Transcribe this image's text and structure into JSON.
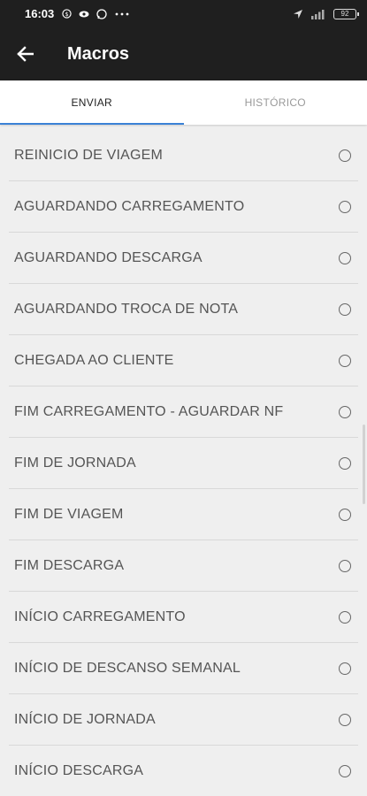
{
  "status_bar": {
    "time": "16:03",
    "battery": "92"
  },
  "app_bar": {
    "title": "Macros"
  },
  "tabs": [
    {
      "label": "ENVIAR",
      "active": true
    },
    {
      "label": "HISTÓRICO",
      "active": false
    }
  ],
  "macros": [
    {
      "label": "REINICIO DE VIAGEM"
    },
    {
      "label": "AGUARDANDO CARREGAMENTO"
    },
    {
      "label": "AGUARDANDO DESCARGA"
    },
    {
      "label": "AGUARDANDO TROCA DE NOTA"
    },
    {
      "label": "CHEGADA AO CLIENTE"
    },
    {
      "label": "FIM CARREGAMENTO - AGUARDAR NF"
    },
    {
      "label": "FIM DE JORNADA"
    },
    {
      "label": "FIM DE VIAGEM"
    },
    {
      "label": "FIM DESCARGA"
    },
    {
      "label": "INÍCIO CARREGAMENTO"
    },
    {
      "label": "INÍCIO DE DESCANSO SEMANAL"
    },
    {
      "label": "INÍCIO DE JORNADA"
    },
    {
      "label": "INÍCIO DESCARGA"
    }
  ],
  "colors": {
    "app_bar": "#1f1f1f",
    "tab_indicator": "#3b82d6",
    "background": "#efefef"
  },
  "icons": {
    "back": "arrow-left-icon",
    "radio": "radio-unchecked-icon"
  }
}
